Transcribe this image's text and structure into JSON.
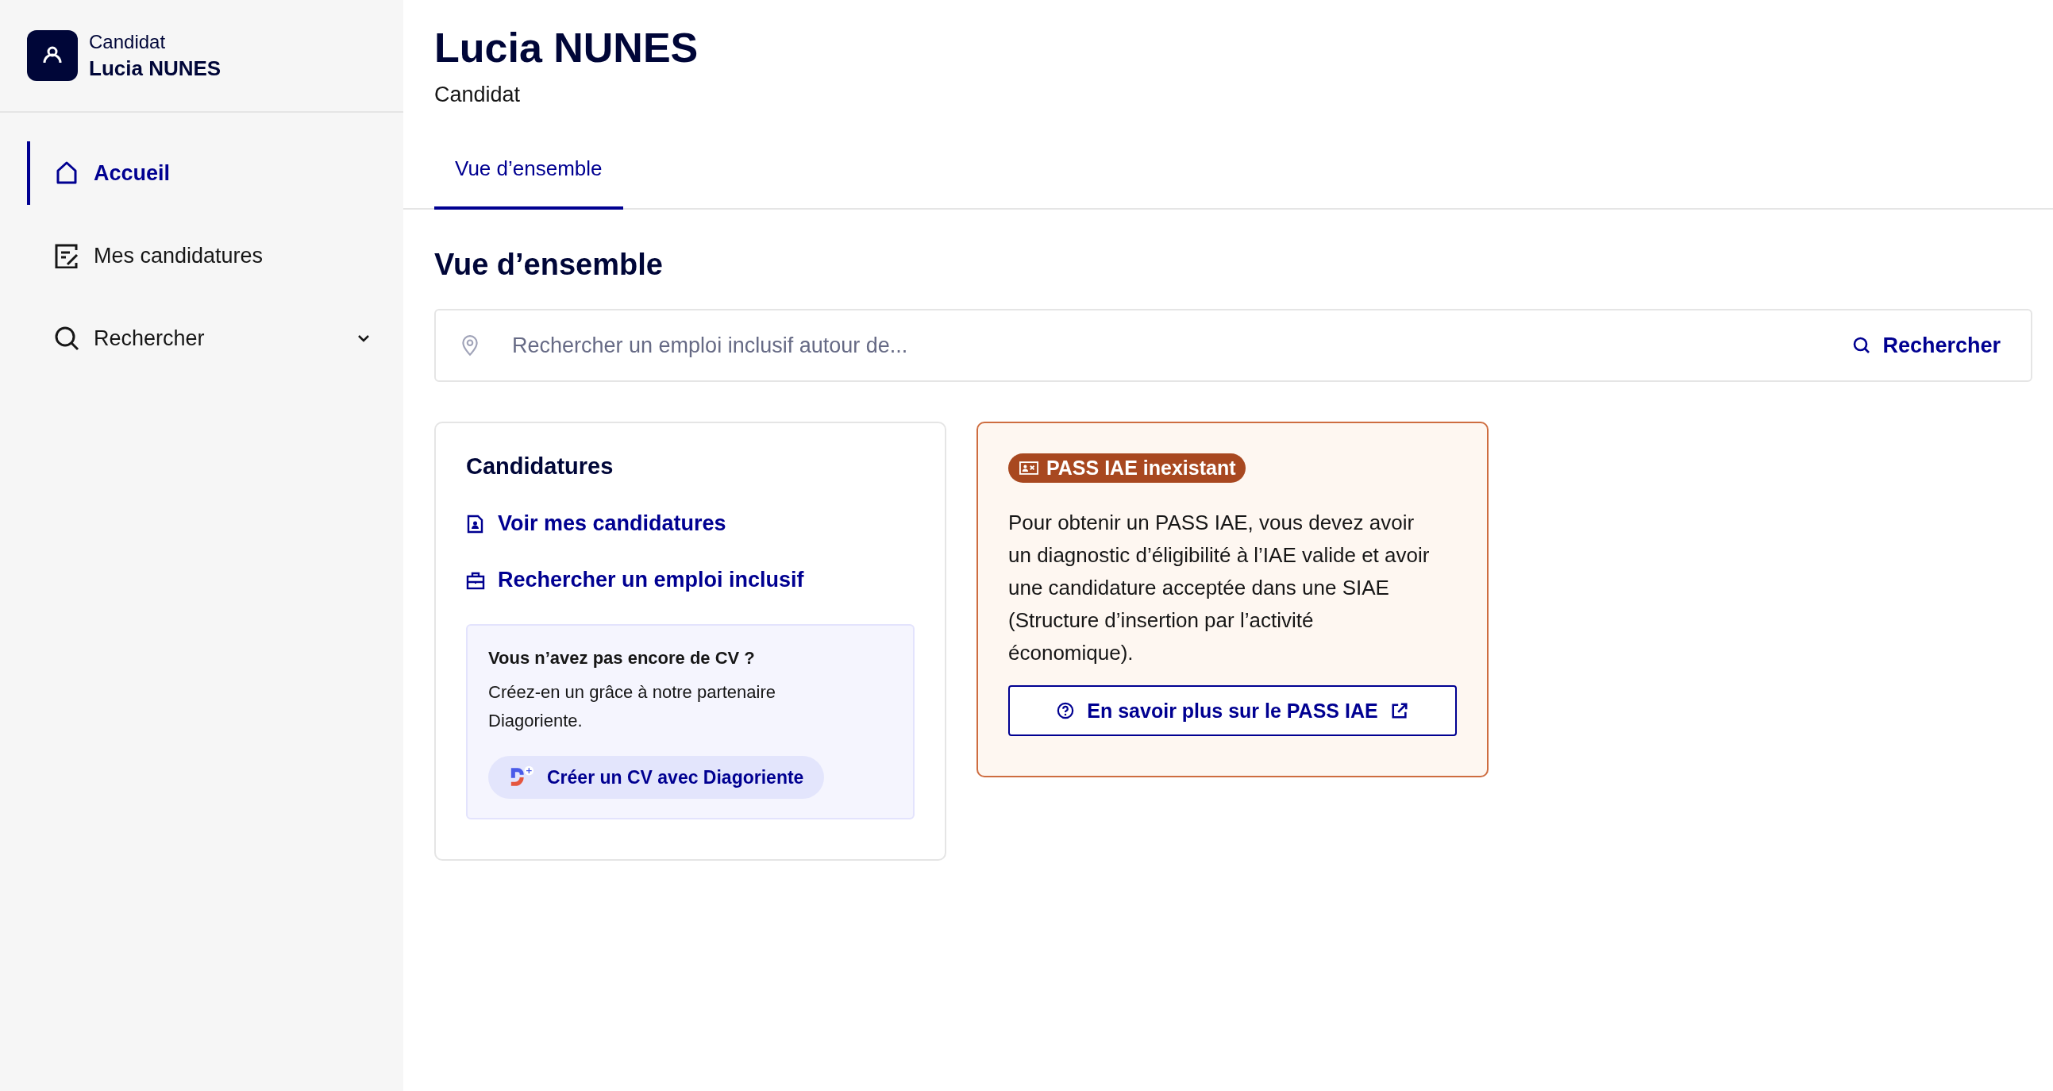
{
  "sidebar": {
    "user": {
      "role": "Candidat",
      "name": "Lucia NUNES"
    },
    "items": [
      {
        "label": "Accueil",
        "selected": true,
        "expandable": false
      },
      {
        "label": "Mes candidatures",
        "selected": false,
        "expandable": false
      },
      {
        "label": "Rechercher",
        "selected": false,
        "expandable": true
      }
    ]
  },
  "header": {
    "title": "Lucia NUNES",
    "subtitle": "Candidat"
  },
  "tabs": [
    {
      "label": "Vue d’ensemble",
      "selected": true
    }
  ],
  "section_title": "Vue d’ensemble",
  "search": {
    "placeholder": "Rechercher un emploi inclusif autour de...",
    "button": "Rechercher"
  },
  "applications_card": {
    "title": "Candidatures",
    "links": [
      {
        "label": "Voir mes candidatures"
      },
      {
        "label": "Rechercher un emploi inclusif"
      }
    ],
    "cv_box": {
      "title": "Vous n’avez pas encore de CV ?",
      "text": "Créez-en un grâce à notre partenaire Diagoriente.",
      "button": "Créer un CV avec Diagoriente"
    }
  },
  "pass_card": {
    "badge": "PASS IAE inexistant",
    "text": "Pour obtenir un PASS IAE, vous devez avoir un diagnostic d’éligibilité à l’IAE valide et avoir une candidature acceptée dans une SIAE (Structure d’insertion par l’activité économique).",
    "button": "En savoir plus sur le PASS IAE"
  }
}
